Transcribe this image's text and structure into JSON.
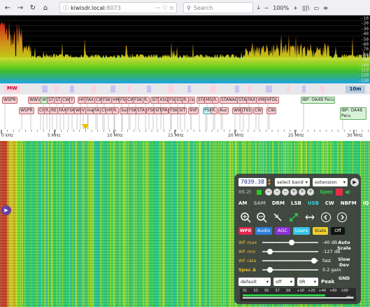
{
  "browser": {
    "url_host": "kiwisdr.local",
    "url_port": ":8073",
    "search_placeholder": "Search",
    "zoom": "100%",
    "back": "←",
    "forward": "→",
    "reload": "↻",
    "home": "⌂"
  },
  "spectrum": {
    "db_labels": [
      "-10",
      "-20",
      "-30",
      "-40",
      "-50",
      "-60",
      "-70",
      "-80",
      "-90",
      "-100",
      "-110",
      "-120",
      "-130"
    ]
  },
  "bands": {
    "mw_label": "MW",
    "m10_label": "10m"
  },
  "labels": [
    {
      "text": "WSPR",
      "color": "pink"
    },
    {
      "text": "WSPR",
      "color": "pink"
    },
    {
      "text": "WWVH",
      "color": "pink"
    },
    {
      "text": "WS",
      "color": "green"
    },
    {
      "text": "ST",
      "color": "pink"
    },
    {
      "text": "ST",
      "color": "pink"
    },
    {
      "text": "CW",
      "color": "pink"
    },
    {
      "text": "Y",
      "color": "pink"
    },
    {
      "text": "HFD",
      "color": "pink"
    },
    {
      "text": "FAX",
      "color": "pink"
    },
    {
      "text": "CW",
      "color": "pink"
    },
    {
      "text": "FSK",
      "color": "pink"
    },
    {
      "text": "HM",
      "color": "pink"
    },
    {
      "text": "FSK",
      "color": "pink"
    },
    {
      "text": "CW",
      "color": "pink"
    },
    {
      "text": "FSK",
      "color": "pink"
    },
    {
      "text": "R.",
      "color": "pink"
    },
    {
      "text": "SIT",
      "color": "pink"
    },
    {
      "text": "XSQ",
      "color": "pink"
    },
    {
      "text": "FSK",
      "color": "pink"
    },
    {
      "text": "STA",
      "color": "pink"
    },
    {
      "text": "R.",
      "color": "pink"
    },
    {
      "text": "ra",
      "color": "pink"
    },
    {
      "text": "STA",
      "color": "pink"
    },
    {
      "text": "MS",
      "color": "pink"
    },
    {
      "text": "R.",
      "color": "pink"
    },
    {
      "text": "STANAG",
      "color": "pink"
    },
    {
      "text": "STA",
      "color": "pink"
    },
    {
      "text": "FAX",
      "color": "pink"
    },
    {
      "text": "VMC",
      "color": "pink"
    },
    {
      "text": "HFDL",
      "color": "pink"
    },
    {
      "text": "CW",
      "color": "pink"
    },
    {
      "text": "IBP: OA4B Peru",
      "color": "green"
    },
    {
      "text": "CHI",
      "color": "pink"
    },
    {
      "text": "R.",
      "color": "pink"
    },
    {
      "text": "RE",
      "color": "pink"
    },
    {
      "text": "FAX",
      "color": "pink"
    },
    {
      "text": "FSK",
      "color": "pink"
    },
    {
      "text": "WF",
      "color": "pink"
    },
    {
      "text": "V",
      "color": "pink"
    },
    {
      "text": "ma",
      "color": "pink"
    },
    {
      "text": "FA",
      "color": "pink"
    },
    {
      "text": "CW",
      "color": "pink"
    },
    {
      "text": "HF",
      "color": "pink"
    },
    {
      "text": "R.",
      "color": "pink"
    },
    {
      "text": "Sui",
      "color": "pink"
    },
    {
      "text": "FSK",
      "color": "pink"
    },
    {
      "text": "STA",
      "color": "pink"
    },
    {
      "text": "FSK",
      "color": "pink"
    },
    {
      "text": "SIT",
      "color": "pink"
    },
    {
      "text": "PA",
      "color": "pink"
    },
    {
      "text": "FSK",
      "color": "pink"
    },
    {
      "text": "SIT",
      "color": "pink"
    },
    {
      "text": "9VF",
      "color": "pink"
    },
    {
      "text": "PSK",
      "color": "cyan"
    },
    {
      "text": "R.",
      "color": "pink"
    },
    {
      "text": "Auc",
      "color": "pink"
    },
    {
      "text": "WWV",
      "color": "pink"
    },
    {
      "text": "JT65",
      "color": "pink"
    },
    {
      "text": "CW",
      "color": "pink"
    },
    {
      "text": "IBP: OA4B Peru",
      "color": "green"
    }
  ],
  "scale": {
    "ticks": [
      "0 kHz",
      "5 MHz",
      "10 MHz",
      "15 MHz",
      "20 MHz",
      "25 MHz",
      "30 MHz"
    ]
  },
  "panel": {
    "frequency": "7039.38",
    "band_select": "select band",
    "extension_select": "extension",
    "spec_label": "Spec",
    "db_readout": "86.2t",
    "modes": [
      "AM",
      "SAM",
      "DRM",
      "LSB",
      "USB",
      "CW",
      "NBFM",
      "IQ"
    ],
    "active_mode": "USB",
    "tabs": [
      "WF0",
      "Audio",
      "AGC",
      "Users",
      "Stats",
      "Off"
    ],
    "sliders": [
      {
        "label": "WF max",
        "value": "-40 dB",
        "level": 0.55
      },
      {
        "label": "WF min",
        "value": "-127 dB",
        "level": 0.14
      },
      {
        "label": "WF rate",
        "value": "fast",
        "level": 0.97
      },
      {
        "label": "Spec Δ",
        "value": "0.2 gain",
        "level": 0.14
      }
    ],
    "side_buttons": [
      "Auto Scale",
      "Slow Dev",
      "GND"
    ],
    "bottom": {
      "sel1": "default",
      "sel2": "off",
      "sel3": "IIR",
      "peak": "Peak"
    },
    "smeter_labels": [
      "S1",
      "S3",
      "S5",
      "S7",
      "S9",
      "+10",
      "+20",
      "+40",
      "+60",
      "-100"
    ],
    "smeter_unit": "dBm"
  },
  "colors": {
    "accent_usb": "#36d4e4",
    "wf0": "#e2254c",
    "audio": "#2f7fd8",
    "agc": "#8c2fd8",
    "users": "#36c4e4",
    "stats": "#f0d230"
  }
}
